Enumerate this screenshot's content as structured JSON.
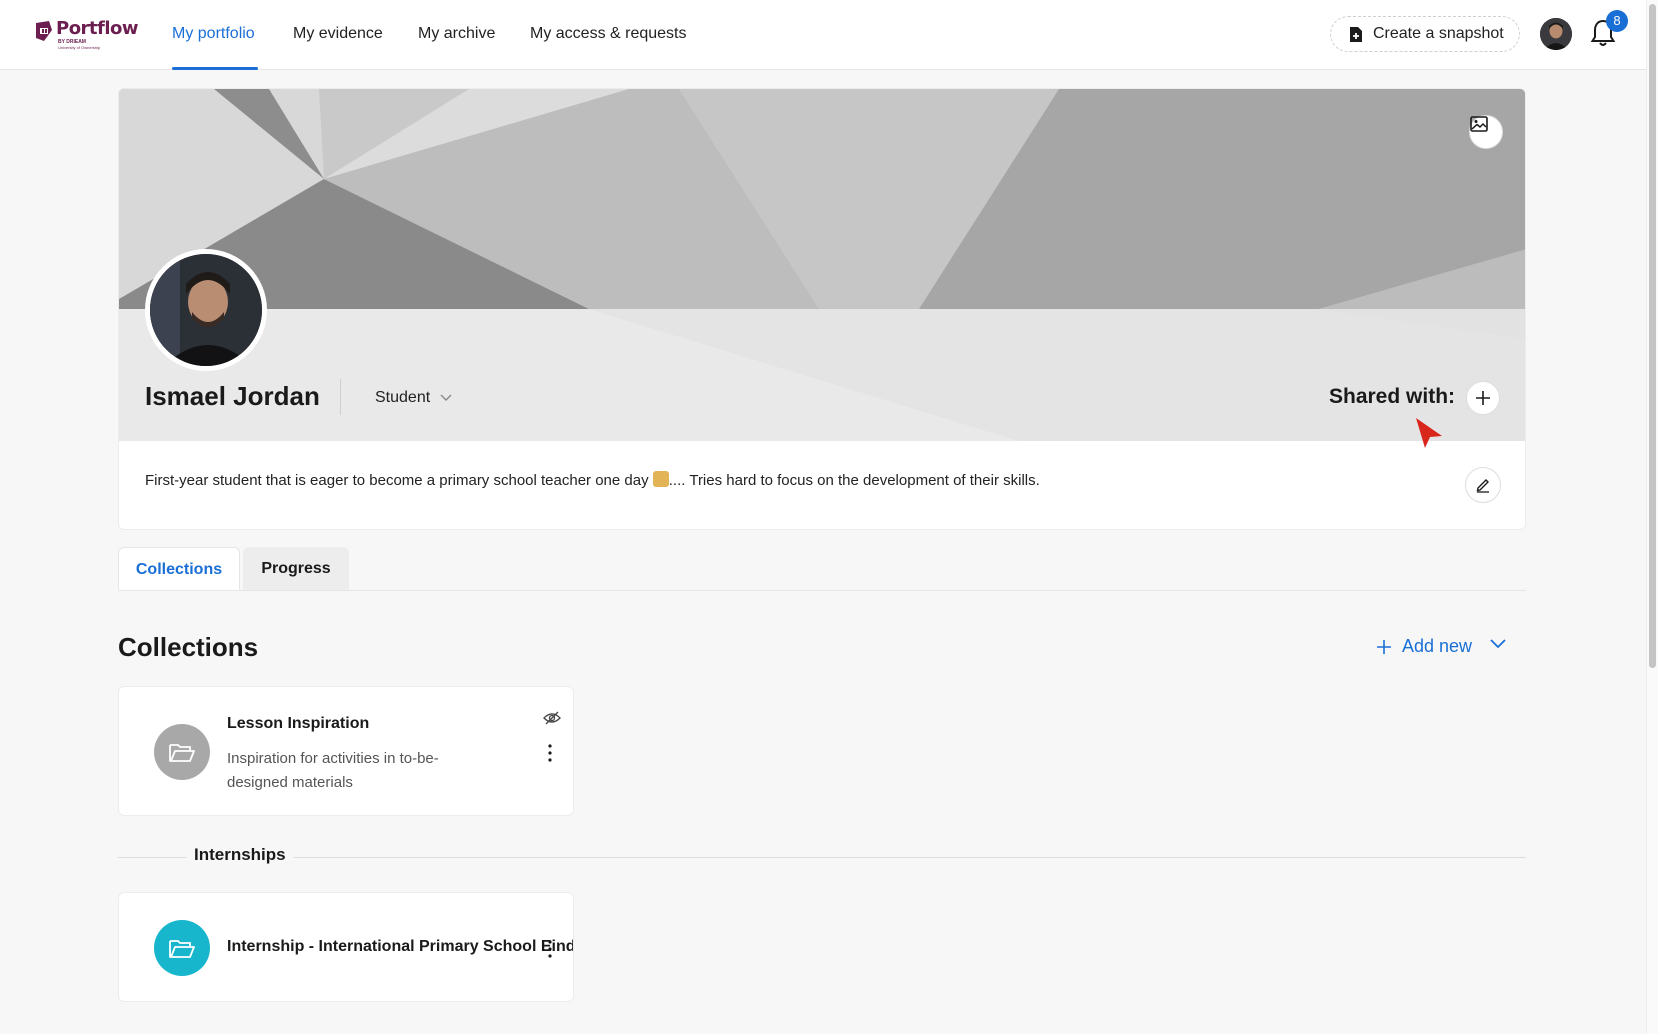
{
  "brand": {
    "name": "Portflow",
    "tagline": "BY DRIEAM",
    "subtagline": "University of Ownership",
    "color": "#6b1e4f"
  },
  "nav": {
    "items": [
      {
        "label": "My portfolio",
        "active": true
      },
      {
        "label": "My evidence",
        "active": false
      },
      {
        "label": "My archive",
        "active": false
      },
      {
        "label": "My access & requests",
        "active": false
      }
    ],
    "snapshot_label": "Create a snapshot",
    "notification_count": "8",
    "accent": "#1a6fd6"
  },
  "profile": {
    "name": "Ismael Jordan",
    "role": "Student",
    "shared_with_label": "Shared with:",
    "bio": "First-year student that is eager to become a primary school teacher one day",
    "bio_suffix": ".... Tries hard to focus on the development of their skills."
  },
  "tabs": [
    {
      "label": "Collections",
      "active": true
    },
    {
      "label": "Progress",
      "active": false
    }
  ],
  "collections": {
    "title": "Collections",
    "add_new_label": "Add new",
    "items": [
      {
        "title": "Lesson Inspiration",
        "description": "Inspiration for activities in to-be-designed materials",
        "icon": "folder-open-icon",
        "color": "#a8a8a8",
        "hidden": true
      }
    ],
    "groups": [
      {
        "label": "Internships",
        "items": [
          {
            "title": "Internship - International Primary School Eindh",
            "icon": "folder-open-icon",
            "color": "#17b6cc"
          }
        ]
      }
    ]
  }
}
